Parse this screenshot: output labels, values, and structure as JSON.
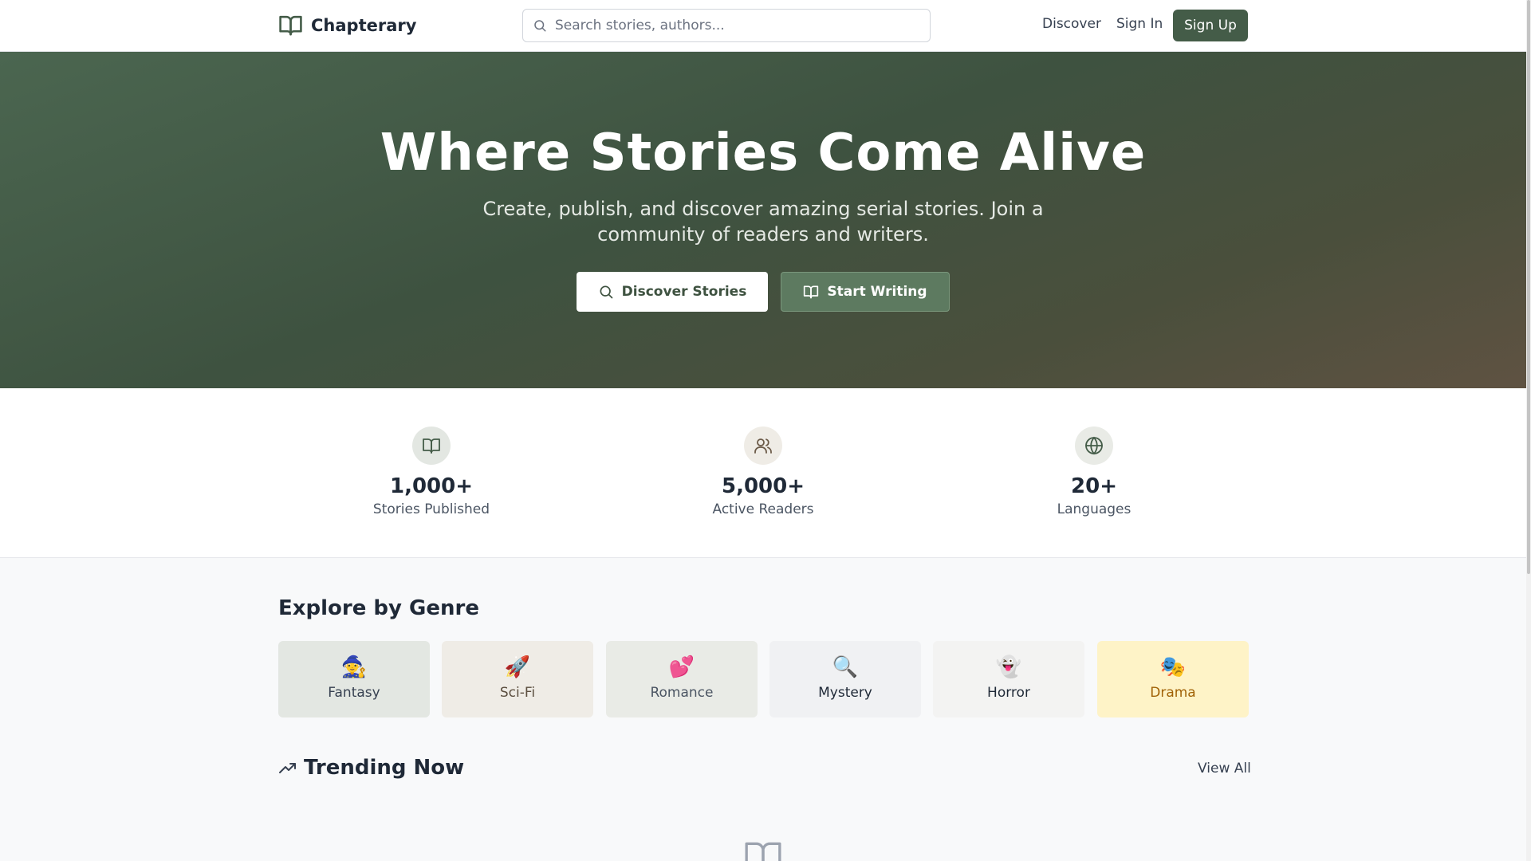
{
  "header": {
    "brand": "Chapterary",
    "search_placeholder": "Search stories, authors...",
    "nav": {
      "discover": "Discover",
      "sign_in": "Sign In",
      "sign_up": "Sign Up"
    }
  },
  "hero": {
    "title": "Where Stories Come Alive",
    "subtitle": "Create, publish, and discover amazing serial stories. Join a community of readers and writers.",
    "discover_button": "Discover Stories",
    "write_button": "Start Writing"
  },
  "stats": [
    {
      "value": "1,000+",
      "label": "Stories Published",
      "icon": "book-open-icon"
    },
    {
      "value": "5,000+",
      "label": "Active Readers",
      "icon": "users-icon"
    },
    {
      "value": "20+",
      "label": "Languages",
      "icon": "globe-icon"
    }
  ],
  "genres": {
    "title": "Explore by Genre",
    "items": [
      {
        "emoji": "🧙",
        "label": "Fantasy",
        "bg": "#e3e7e2",
        "color": "#374151"
      },
      {
        "emoji": "🚀",
        "label": "Sci-Fi",
        "bg": "#efece6",
        "color": "#5b4e3f"
      },
      {
        "emoji": "💕",
        "label": "Romance",
        "bg": "#e9ebe6",
        "color": "#4b5563"
      },
      {
        "emoji": "🔍",
        "label": "Mystery",
        "bg": "#f0f1f3",
        "color": "#1f2937"
      },
      {
        "emoji": "👻",
        "label": "Horror",
        "bg": "#f3f3f2",
        "color": "#1f2937"
      },
      {
        "emoji": "🎭",
        "label": "Drama",
        "bg": "#fef3c7",
        "color": "#a16207"
      }
    ]
  },
  "trending": {
    "title": "Trending Now",
    "view_all": "View All"
  },
  "colors": {
    "brand": "#445c48",
    "hero_start": "#4b6650",
    "hero_end": "#5f5242"
  }
}
